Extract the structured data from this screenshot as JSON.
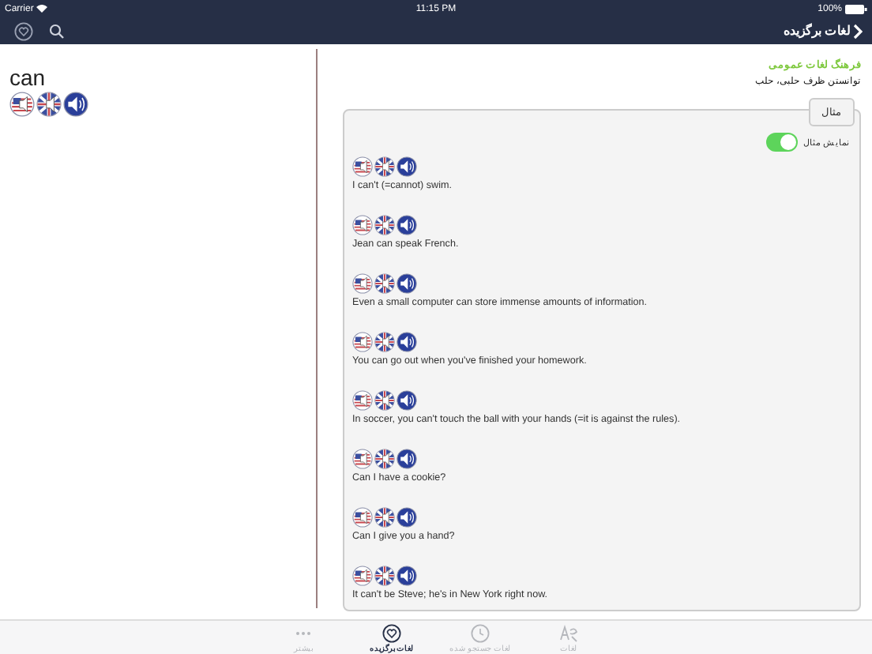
{
  "status_bar": {
    "carrier": "Carrier",
    "time": "11:15 PM",
    "battery": "100%"
  },
  "nav_bar": {
    "title": "لغات برگزیده"
  },
  "word": {
    "text": "can"
  },
  "dictionary": {
    "name": "فرهنگ لغات عمومی",
    "meaning": "توانستن ظرف حلبی، حلب"
  },
  "examples_panel": {
    "tab_label": "مثال",
    "toggle_label": "نمایش مثال",
    "toggle_on": true,
    "examples": [
      {
        "text": "I can't (=cannot) swim."
      },
      {
        "text": "Jean can speak French."
      },
      {
        "text": "Even a small computer can store immense amounts of information."
      },
      {
        "text": "You can go out when you've finished your homework."
      },
      {
        "text": "In soccer, you can't touch the ball with your hands (=it is against the rules)."
      },
      {
        "text": "Can I have a cookie?"
      },
      {
        "text": "Can I give you a hand?"
      },
      {
        "text": "It can't be Steve; he's in New York right now."
      }
    ]
  },
  "tab_bar": [
    {
      "label": "لغات",
      "kind": "words",
      "selected": false
    },
    {
      "label": "لغات جستجو شده",
      "kind": "history",
      "selected": false
    },
    {
      "label": "لغات برگزیده",
      "kind": "favorites",
      "selected": true
    },
    {
      "label": "بیشتر",
      "kind": "more",
      "selected": false
    }
  ]
}
